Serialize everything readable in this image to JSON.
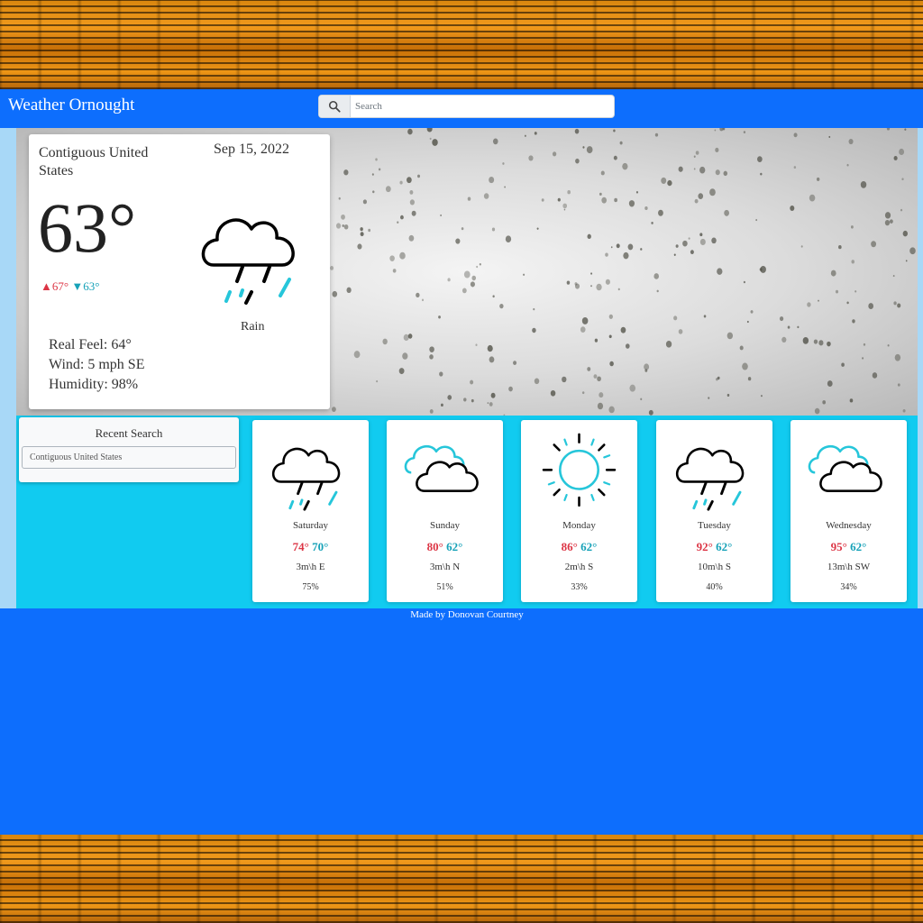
{
  "app": {
    "title": "Weather Ornought"
  },
  "search": {
    "placeholder": "Search",
    "icon": "search-icon"
  },
  "current": {
    "location": "Contiguous United States",
    "date": "Sep 15, 2022",
    "temp": "63°",
    "high": "▲67°",
    "low": "▼63°",
    "condition": "Rain",
    "condition_icon": "rain-cloud-icon",
    "real_feel": "Real Feel: 64°",
    "wind": "Wind: 5 mph SE",
    "humidity": "Humidity: 98%"
  },
  "recent": {
    "title": "Recent Search",
    "items": [
      "Contiguous United States"
    ]
  },
  "forecast": [
    {
      "day": "Saturday",
      "high": "74°",
      "low": "70°",
      "wind": "3m\\h E",
      "humidity": "75%",
      "icon": "rain-cloud-icon"
    },
    {
      "day": "Sunday",
      "high": "80°",
      "low": "62°",
      "wind": "3m\\h N",
      "humidity": "51%",
      "icon": "clouds-icon"
    },
    {
      "day": "Monday",
      "high": "86°",
      "low": "62°",
      "wind": "2m\\h S",
      "humidity": "33%",
      "icon": "sun-icon"
    },
    {
      "day": "Tuesday",
      "high": "92°",
      "low": "62°",
      "wind": "10m\\h S",
      "humidity": "40%",
      "icon": "rain-cloud-icon"
    },
    {
      "day": "Wednesday",
      "high": "95°",
      "low": "62°",
      "wind": "13m\\h SW",
      "humidity": "34%",
      "icon": "clouds-icon"
    }
  ],
  "footer": {
    "text": "Made by Donovan Courtney"
  },
  "colors": {
    "navbar": "#0d6efd",
    "high": "#dc3545",
    "low": "#17a2b8",
    "strip": "#11cbf0"
  }
}
